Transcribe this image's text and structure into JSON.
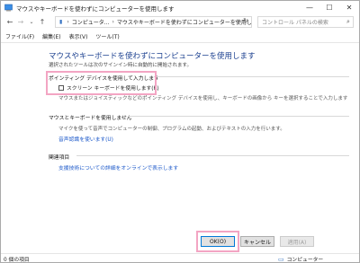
{
  "window": {
    "title": "マウスやキーボードを使わずにコンピューターを使用します",
    "minimize": "—",
    "maximize": "☐",
    "close": "✕"
  },
  "address": {
    "crumb_root": "コンピュータ...",
    "crumb_current": "マウスやキーボードを使わずにコンピューターを使用します",
    "search_placeholder": "コントロール パネルの検索"
  },
  "menu": [
    "ファイル(F)",
    "編集(E)",
    "表示(V)",
    "ツール(T)"
  ],
  "main": {
    "title": "マウスやキーボードを使わずにコンピューターを使用します",
    "subtitle": "選択されたツールは次のサインイン時に自動的に開始されます。",
    "pointing_group": "ポインティング デバイスを使用して入力します",
    "screen_keyboard_label": "スクリーン キーボードを使用します(K)",
    "pointing_desc": "マウスまたはジョイスティックなどのポインティング デバイスを使用し、キーボードの画像から キーを選択することで入力します",
    "speech_group": "マウスとキーボードを使用しません",
    "speech_desc": "マイクを使って音声でコンピューターの制御、プログラムの起動、およびテキストの入力を行います。",
    "speech_link": "音声認識を使います(U)",
    "related_group": "関連項目",
    "related_link": "支援技術についての詳細をオンラインで表示します"
  },
  "buttons": {
    "ok": "OK(O)",
    "cancel": "キャンセル",
    "apply": "適用(A)"
  },
  "status": {
    "items": "0 個の項目",
    "location": "コンピューター"
  }
}
